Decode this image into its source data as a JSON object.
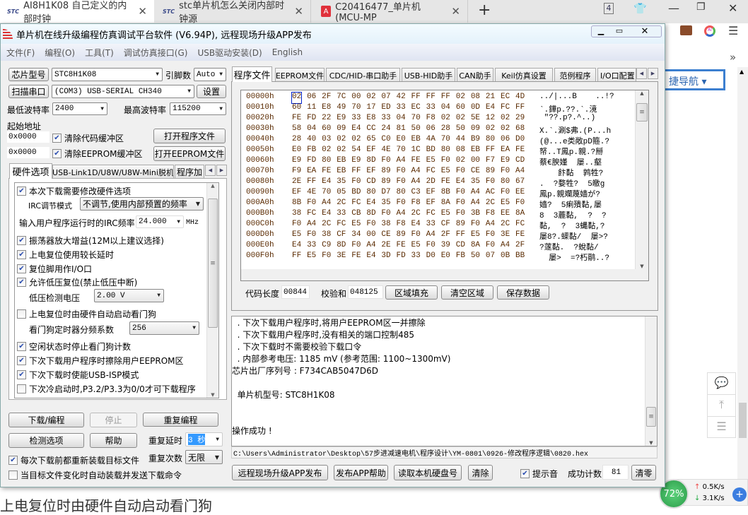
{
  "browser": {
    "tabs": [
      {
        "label": "AI8H1K08 自己定义的内部时钟",
        "active": true
      },
      {
        "label": "stc单片机怎么关闭内部时钟源",
        "active": false
      },
      {
        "label": "C20416477_单片机(MCU-MP",
        "active": false
      }
    ],
    "new_tab": "+",
    "tab_count": "4",
    "nav_label": "捷导航 ▾",
    "more": "»",
    "net_widget": {
      "percent": "72%",
      "upload": "0.5K/s",
      "download": "3.1K/s"
    },
    "behind_text": "上电复位时由硬件自动启动看门狗"
  },
  "app": {
    "title": "单片机在线升级编程仿真调试平台软件 (V6.94P), 远程现场升级APP发布",
    "menu": [
      "文件(F)",
      "编程(O)",
      "工具(T)",
      "调试仿真接口(G)",
      "USB驱动安装(D)",
      "English"
    ],
    "left": {
      "chip_btn": "芯片型号",
      "chip_value": "STC8H1K08",
      "pins_label": "引脚数",
      "pins_value": "Auto",
      "scan_btn": "扫描串口",
      "port_value": "(COM3) USB-SERIAL CH340",
      "settings_btn": "设置",
      "min_baud_label": "最低波特率",
      "min_baud": "2400",
      "max_baud_label": "最高波特率",
      "max_baud": "115200",
      "start_addr_label": "起始地址",
      "addr1": "0x0000",
      "clear_code": "清除代码缓冲区",
      "open_prog": "打开程序文件",
      "addr2": "0x0000",
      "clear_eeprom": "清除EEPROM缓冲区",
      "open_eeprom": "打开EEPROM文件",
      "tabs": [
        "硬件选项",
        "USB-Link1D/U8W/U8W-Mini脱机",
        "程序加"
      ],
      "options": {
        "modify_hw": {
          "label": "本次下载需要修改硬件选项",
          "checked": true
        },
        "irc_mode_label": "IRC调节模式",
        "irc_mode": "不调节,使用内部预置的频率",
        "irc_freq_label": "输入用户程序运行时的IRC频率",
        "irc_freq": "24.000",
        "irc_unit": "MHz",
        "osc_gain": {
          "label": "振荡器放大增益(12M以上建议选择)",
          "checked": true
        },
        "long_delay": {
          "label": "上电复位使用较长延时",
          "checked": true
        },
        "reset_io": {
          "label": "复位脚用作I/O口",
          "checked": true
        },
        "lvr": {
          "label": "允许低压复位(禁止低压中断)",
          "checked": true
        },
        "lvd_label": "低压检测电压",
        "lvd": "2.00 V",
        "wdt_auto": {
          "label": "上电复位时由硬件自动启动看门狗",
          "checked": false
        },
        "wdt_div_label": "看门狗定时器分频系数",
        "wdt_div": "256",
        "wdt_idle": {
          "label": "空闲状态时停止看门狗计数",
          "checked": true
        },
        "erase_eeprom": {
          "label": "下次下载用户程序时擦除用户EEPROM区",
          "checked": true
        },
        "usb_isp": {
          "label": "下次下载时使能USB-ISP模式",
          "checked": true
        },
        "cold_boot": {
          "label": "下次冷启动时,P3.2/P3.3为0/0才可下载程序",
          "checked": false
        }
      },
      "download_btn": "下载/编程",
      "stop_btn": "停止",
      "repeat_btn": "重复编程",
      "detect_btn": "检测选项",
      "help_btn": "帮助",
      "repeat_delay_label": "重复延时",
      "repeat_delay": "3 秒",
      "repeat_count_label": "重复次数",
      "repeat_count": "无限",
      "reload": {
        "label": "每次下载前都重新装载目标文件",
        "checked": true
      },
      "auto_send": {
        "label": "当目标文件变化时自动装载并发送下载命令",
        "checked": false
      }
    },
    "right": {
      "tabs": [
        "程序文件",
        "EEPROM文件",
        "CDC/HID-串口助手",
        "USB-HID助手",
        "CAN助手",
        "Keil仿真设置",
        "范例程序",
        "I/O口配置"
      ],
      "hex_rows": [
        {
          "addr": "00000h",
          "bytes": "02 06 2F 7C 00 02 07 42 FF FF FF 02 08 21 EC 4D",
          "ascii": "../|...B    ..!?"
        },
        {
          "addr": "00010h",
          "bytes": "60 11 E8 49 70 17 ED 33 EC 33 04 60 0D E4 FC FF",
          "ascii": "`.鏵p.??.`.滰"
        },
        {
          "addr": "00020h",
          "bytes": "FE FD 22 E9 33 E8 33 04 70 F8 02 02 5E 12 02 29",
          "ascii": " \"??.p?.^..)"
        },
        {
          "addr": "00030h",
          "bytes": "58 04 60 09 E4 CC 24 81 50 06 28 50 09 02 02 68",
          "ascii": "X.`.涮$弗.(P...h"
        },
        {
          "addr": "00040h",
          "bytes": "28 40 03 02 02 65 C0 E0 EB 4A 70 44 B9 80 06 D0",
          "ascii": "(@...e类敞pD箍.?"
        },
        {
          "addr": "00050h",
          "bytes": "E0 FB 02 02 54 EF 4E 70 1C BD 80 08 EB FF EA FE",
          "ascii": "帑..T鳳p.親.?掰"
        },
        {
          "addr": "00060h",
          "bytes": "E9 FD 80 EB E9 8D F0 A4 FE E5 F0 02 00 F7 E9 CD",
          "ascii": "蔡€腴嫤  屡..壑"
        },
        {
          "addr": "00070h",
          "bytes": "F9 EA FE EB FF EF 89 F0 A4 FC E5 F0 CE 89 F0 A4",
          "ascii": "    飰黏  鹑牲?"
        },
        {
          "addr": "00080h",
          "bytes": "2E FF E4 35 F0 CD 89 F0 A4 2D FE E4 35 F0 80 67",
          "ascii": ".  ?婺牲?  5皦g"
        },
        {
          "addr": "00090h",
          "bytes": "EF 4E 70 05 BD 80 D7 80 C3 EF 8B F0 A4 AC F0 EE",
          "ascii": "鳳p.親斕蔑嫱が?"
        },
        {
          "addr": "000A0h",
          "bytes": "8B F0 A4 2C FC E4 35 F0 F8 EF 8A F0 A4 2C E5 F0",
          "ascii": "嫱?  5瘌殨黏,屡"
        },
        {
          "addr": "000B0h",
          "bytes": "38 FC E4 33 CB 8D F0 A4 2C FC E5 F0 3B F8 EE 8A",
          "ascii": "8  3蔍黏,  ?  ?"
        },
        {
          "addr": "000C0h",
          "bytes": "F0 A4 2C FC E5 F0 38 F8 E4 33 CF 89 F0 A4 2C FC",
          "ascii": "黏,  ?  3蝿黏,?"
        },
        {
          "addr": "000D0h",
          "bytes": "E5 F0 38 CF 34 00 CE 89 F0 A4 2F FF E5 F0 3E FE",
          "ascii": "屡8?.蟝黏/  屡>?"
        },
        {
          "addr": "000E0h",
          "bytes": "E4 33 C9 8D F0 A4 2E FE E5 F0 39 CD 8A F0 A4 2F",
          "ascii": "?蓫黏.  ?蛻黏/"
        },
        {
          "addr": "000F0h",
          "bytes": "FF E5 F0 3E FE E4 3D FD 33 D0 E0 FB 50 07 0B BB",
          "ascii": "  屡>  =?朽鹝..?"
        }
      ],
      "code_len_label": "代码长度",
      "code_len": "00844",
      "checksum_label": "校验和",
      "checksum": "048125",
      "fill_btn": "区域填充",
      "clear_btn": "清空区域",
      "save_btn": "保存数据",
      "log": [
        "  . 下次下载用户程序时,将用户EEPROM区一并擦除",
        "  . 下次下载用户程序时,没有相关的端口控制485",
        "  . 下次下载时不需要校验下载口令",
        "  . 内部参考电压: 1185 mV (参考范围: 1100~1300mV)",
        "芯片出厂序列号 : F734CAB5047D6D",
        "",
        "  单片机型号: STC8H1K08",
        "",
        "",
        "操作成功 !"
      ],
      "file_path": "C:\\Users\\Administrator\\Desktop\\57步进减速电机\\程序设计\\YM-0801\\0926-修改程序逻辑\\0820.hex",
      "remote_btn": "远程现场升级APP发布",
      "publish_help_btn": "发布APP帮助",
      "read_disk_btn": "读取本机硬盘号",
      "clear_log_btn": "清除",
      "beep": {
        "label": "提示音",
        "checked": true
      },
      "success_label": "成功计数",
      "success_count": "81",
      "reset_btn": "清零"
    }
  },
  "colors": {
    "accent": "#3c7fd0",
    "selection": "#3399ff",
    "hex_text": "#5a2a00",
    "widget_green": "#3cb55a"
  }
}
